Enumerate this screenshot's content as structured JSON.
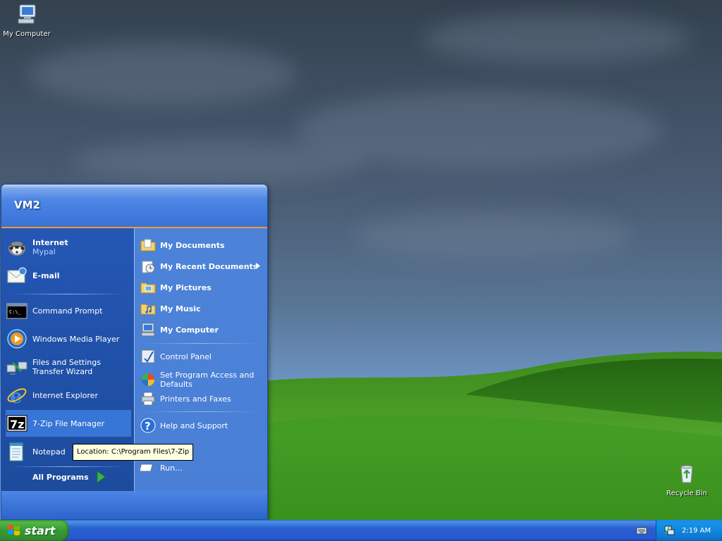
{
  "desktop": {
    "icons": [
      {
        "label": "My Computer"
      },
      {
        "label": "Recycle Bin"
      }
    ]
  },
  "start_menu": {
    "user_name": "VM2",
    "pinned": [
      {
        "title": "Internet",
        "subtitle": "Mypal",
        "icon": "raccoon-browser-icon"
      },
      {
        "title": "E-mail",
        "icon": "email-icon"
      }
    ],
    "recent": [
      {
        "label": "Command Prompt",
        "icon": "command-prompt-icon"
      },
      {
        "label": "Windows Media Player",
        "icon": "media-player-icon"
      },
      {
        "label": "Files and Settings Transfer Wizard",
        "icon": "transfer-wizard-icon"
      },
      {
        "label": "Internet Explorer",
        "icon": "internet-explorer-icon"
      },
      {
        "label": "7-Zip File Manager",
        "icon": "7zip-icon"
      },
      {
        "label": "Notepad",
        "icon": "notepad-icon"
      }
    ],
    "all_programs": "All Programs",
    "places": [
      {
        "label": "My Documents",
        "icon": "folder-documents-icon"
      },
      {
        "label": "My Recent Documents",
        "icon": "recent-documents-icon"
      },
      {
        "label": "My Pictures",
        "icon": "folder-pictures-icon"
      },
      {
        "label": "My Music",
        "icon": "folder-music-icon"
      },
      {
        "label": "My Computer",
        "icon": "computer-icon"
      }
    ],
    "system": [
      {
        "label": "Control Panel",
        "icon": "control-panel-icon"
      },
      {
        "label": "Set Program Access and Defaults",
        "icon": "program-access-icon"
      },
      {
        "label": "Printers and Faxes",
        "icon": "printer-icon"
      },
      {
        "label": "Help and Support",
        "icon": "help-icon"
      },
      {
        "label": "Run...",
        "icon": "run-icon"
      }
    ],
    "tooltip": "Location: C:\\Program Files\\7-Zip"
  },
  "taskbar": {
    "start_label": "start",
    "clock": "2:19 AM"
  }
}
